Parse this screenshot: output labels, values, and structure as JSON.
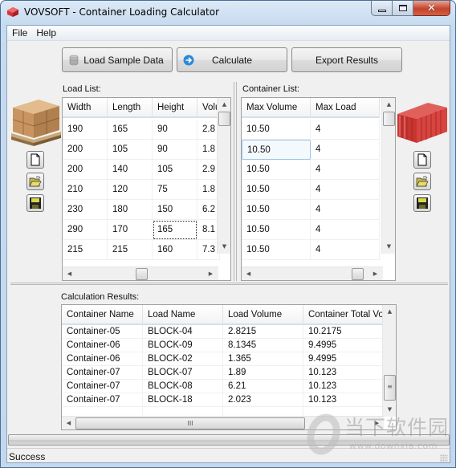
{
  "window": {
    "title": "VOVSOFT - Container Loading Calculator",
    "caption_buttons": {
      "minimize": "minimize",
      "maximize": "maximize",
      "close": "✕"
    }
  },
  "menu": {
    "items": [
      {
        "label": "File"
      },
      {
        "label": "Help"
      }
    ]
  },
  "toolbar": {
    "load_sample_label": "Load Sample Data",
    "calculate_label": "Calculate",
    "export_label": "Export Results"
  },
  "load_list": {
    "label": "Load List:",
    "columns": [
      "Width",
      "Length",
      "Height",
      "Volu"
    ],
    "rows": [
      [
        "190",
        "165",
        "90",
        "2.8"
      ],
      [
        "200",
        "105",
        "90",
        "1.8"
      ],
      [
        "200",
        "140",
        "105",
        "2.9"
      ],
      [
        "210",
        "120",
        "75",
        "1.8"
      ],
      [
        "230",
        "180",
        "150",
        "6.2"
      ],
      [
        "290",
        "170",
        "165",
        "8.1"
      ],
      [
        "215",
        "215",
        "160",
        "7.3"
      ]
    ],
    "focused_cell": {
      "row": 5,
      "col": 2
    }
  },
  "container_list": {
    "label": "Container List:",
    "columns": [
      "Max Volume",
      "Max Load"
    ],
    "rows": [
      [
        "10.50",
        "4"
      ],
      [
        "10.50",
        "4"
      ],
      [
        "10.50",
        "4"
      ],
      [
        "10.50",
        "4"
      ],
      [
        "10.50",
        "4"
      ],
      [
        "10.50",
        "4"
      ],
      [
        "10.50",
        "4"
      ]
    ],
    "selected_cell": {
      "row": 1,
      "col": 0
    }
  },
  "results": {
    "label": "Calculation Results:",
    "columns": [
      "Container Name",
      "Load Name",
      "Load Volume",
      "Container Total Vol"
    ],
    "rows": [
      [
        "Container-05",
        "BLOCK-04",
        "2.8215",
        "10.2175"
      ],
      [
        "Container-06",
        "BLOCK-09",
        "8.1345",
        "9.4995"
      ],
      [
        "Container-06",
        "BLOCK-02",
        "1.365",
        "9.4995"
      ],
      [
        "Container-07",
        "BLOCK-07",
        "1.89",
        "10.123"
      ],
      [
        "Container-07",
        "BLOCK-08",
        "6.21",
        "10.123"
      ],
      [
        "Container-07",
        "BLOCK-18",
        "2.023",
        "10.123"
      ]
    ],
    "hscroll_grip": "III"
  },
  "progress": {
    "percent": 0
  },
  "status": {
    "text": "Success"
  },
  "watermark": {
    "brand": "当下软件园",
    "url": "www.downxia.com"
  },
  "colors": {
    "accent_blue": "#2a8ad8",
    "close_red": "#c4432a",
    "container_red": "#d83a36"
  }
}
